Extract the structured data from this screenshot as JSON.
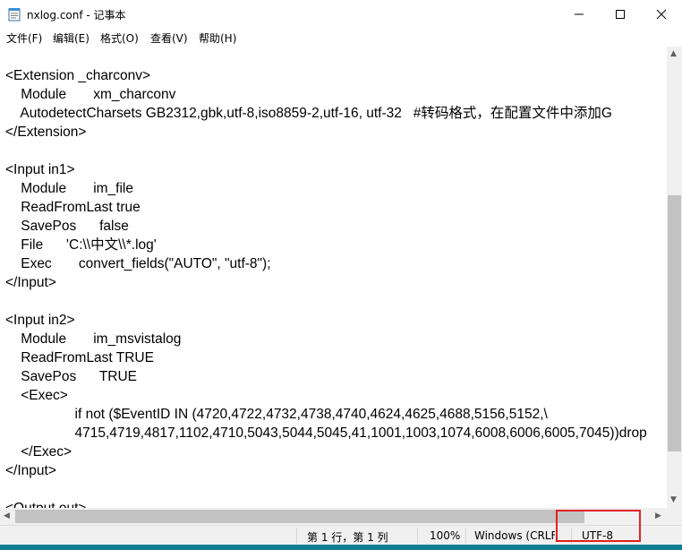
{
  "window": {
    "title": "nxlog.conf - 记事本"
  },
  "window_controls": {
    "minimize_icon": "minimize-icon",
    "maximize_icon": "maximize-icon",
    "close_icon": "close-icon"
  },
  "menu": {
    "items": [
      "文件(F)",
      "编辑(E)",
      "格式(O)",
      "查看(V)",
      "帮助(H)"
    ]
  },
  "editor": {
    "lines": [
      "",
      "<Extension _charconv>",
      "    Module       xm_charconv",
      "    AutodetectCharsets GB2312,gbk,utf-8,iso8859-2,utf-16, utf-32   #转码格式，在配置文件中添加G",
      "</Extension>",
      "",
      "<Input in1>",
      "    Module       im_file",
      "    ReadFromLast true",
      "    SavePos      false",
      "    File      'C:\\\\中文\\\\*.log'",
      "    Exec       convert_fields(\"AUTO\", \"utf-8\");",
      "</Input>",
      "",
      "<Input in2>",
      "    Module       im_msvistalog",
      "    ReadFromLast TRUE",
      "    SavePos      TRUE",
      "    <Exec>",
      "                  if not ($EventID IN (4720,4722,4732,4738,4740,4624,4625,4688,5156,5152,\\",
      "                  4715,4719,4817,1102,4710,5043,5044,5045,41,1001,1003,1074,6008,6006,6005,7045))drop",
      "    </Exec>",
      "</Input>",
      "",
      "<Output out>"
    ]
  },
  "status": {
    "position": "第 1 行，第 1 列",
    "zoom": "100%",
    "line_ending": "Windows (CRLF)",
    "encoding": "UTF-8"
  },
  "colors": {
    "highlight_box": "#e02020",
    "taskbar_strip": "#0f7f8f"
  }
}
